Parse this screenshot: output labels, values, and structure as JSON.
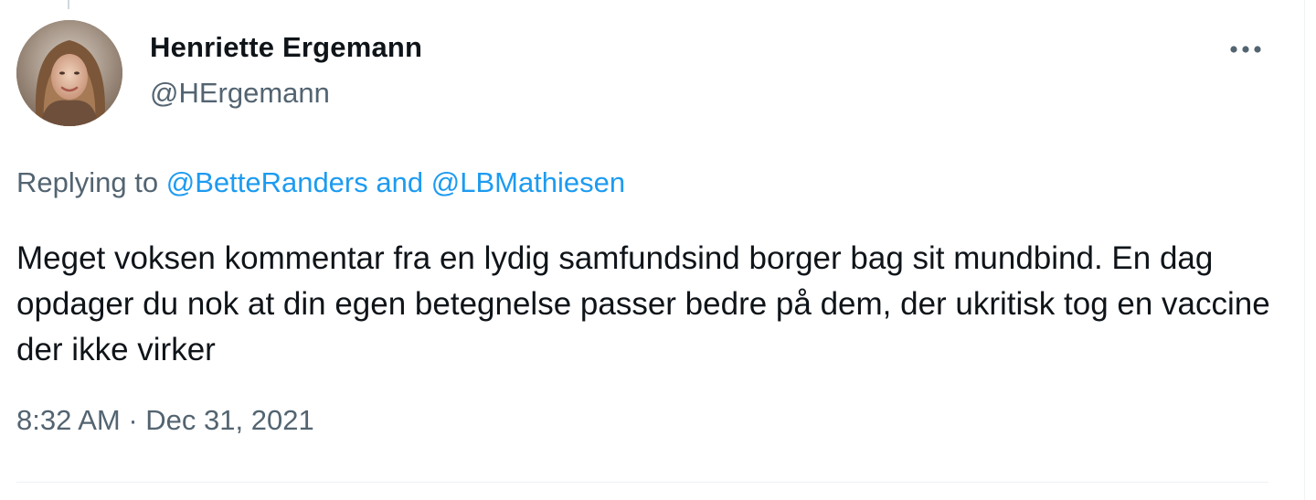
{
  "tweet": {
    "author": {
      "display_name": "Henriette Ergemann",
      "handle": "@HErgemann",
      "avatar_icon": "profile-photo"
    },
    "reply_context": {
      "prefix": "Replying to",
      "mention_1": "@BetteRanders",
      "conjunction": "and",
      "mention_2": "@LBMathiesen"
    },
    "text": "Meget voksen kommentar fra en lydig samfundsind borger bag sit mundbind. En dag opdager du nok at din egen betegnelse passer bedre på dem, der ukritisk tog en vaccine der ikke virker",
    "timestamp": "8:32 AM · Dec 31, 2021",
    "more_icon": "more-horizontal-icon"
  },
  "colors": {
    "primary_text": "#0f1419",
    "secondary_text": "#536471",
    "link": "#1d9bf0",
    "divider": "#eff3f4"
  }
}
